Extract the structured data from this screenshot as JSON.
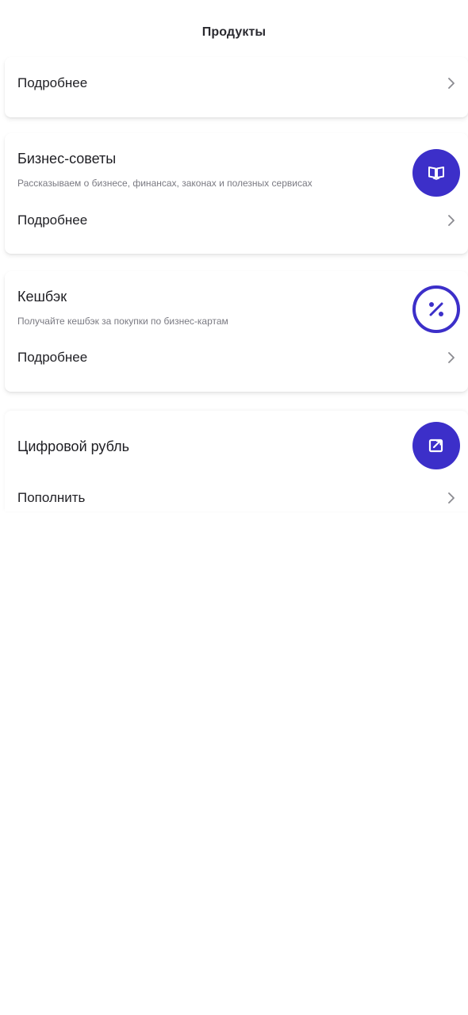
{
  "header": {
    "title": "Продукты"
  },
  "cards": [
    {
      "row_label": "Подробнее"
    },
    {
      "title": "Бизнес-советы",
      "subtitle": "Рассказываем о бизнесе, финансах, законах и полезных сервисах",
      "icon": "book-icon",
      "row_label": "Подробнее"
    },
    {
      "title": "Кешбэк",
      "subtitle": "Получайте кешбэк за покупки по бизнес-картам",
      "icon": "percent-icon",
      "row_label": "Подробнее"
    },
    {
      "title": "Цифровой рубль",
      "icon": "digital-ruble-icon",
      "row_label": "Пополнить"
    }
  ],
  "colors": {
    "accent": "#3c2fc9",
    "text": "#1f1f24",
    "muted": "#7a7a82",
    "chevron": "#8a8a90"
  }
}
